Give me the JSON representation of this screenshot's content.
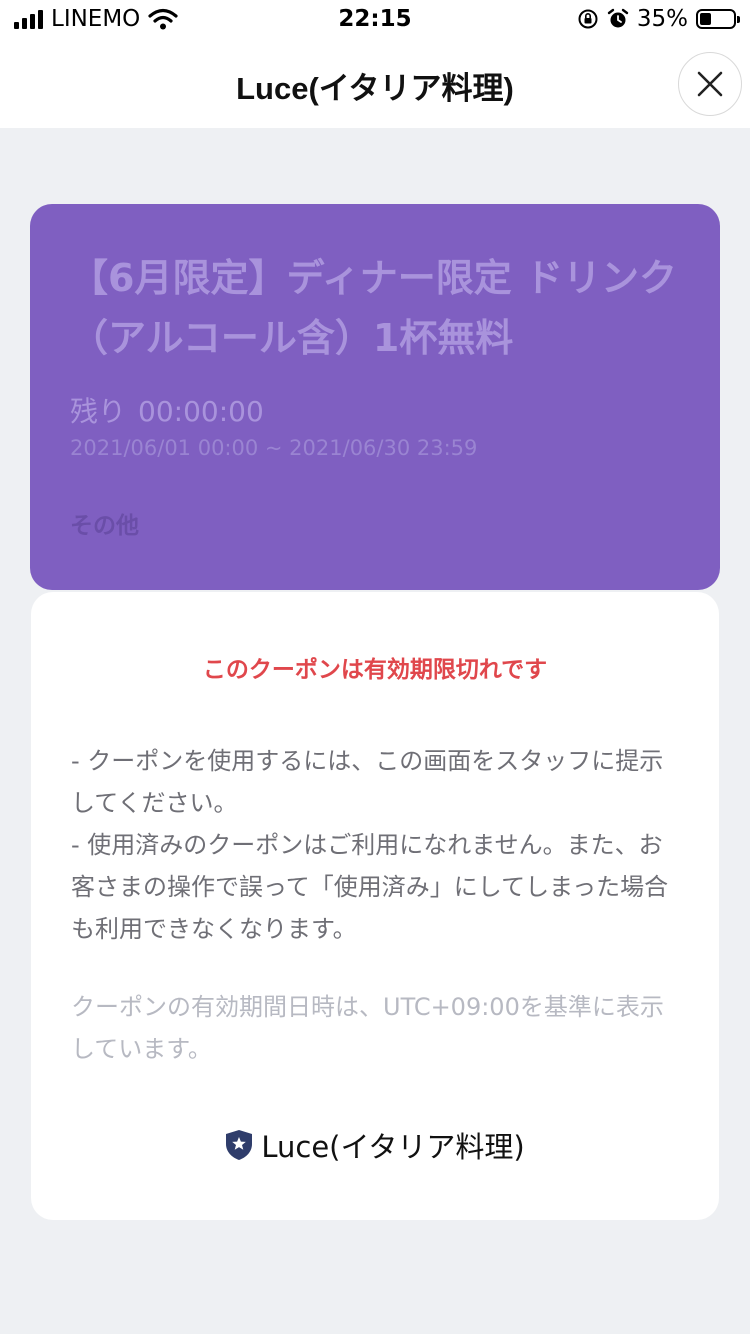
{
  "status_bar": {
    "carrier": "LINEMO",
    "time": "22:15",
    "battery_percent": "35%",
    "battery_level": 0.35,
    "icons": [
      "signal-bars-icon",
      "wifi-icon",
      "orientation-lock-icon",
      "alarm-icon",
      "battery-icon"
    ]
  },
  "header": {
    "title": "Luce(イタリア料理)",
    "close_icon": "close-icon"
  },
  "coupon": {
    "title": "【6月限定】ディナー限定 ドリンク（アルコール含）1杯無料",
    "remaining_label": "残り",
    "remaining_value": "00:00:00",
    "period": "2021/06/01 00:00 ~ 2021/06/30 23:59",
    "category": "その他",
    "color": "#7f5fc1"
  },
  "details": {
    "expired_message": "このクーポンは有効期限切れです",
    "note_1": "- クーポンを使用するには、この画面をスタッフに提示してください。",
    "note_2": "- 使用済みのクーポンはご利用になれません。また、お客さまの操作で誤って「使用済み」にしてしまった場合も利用できなくなります。",
    "timezone_note": "クーポンの有効期間日時は、UTC+09:00を基準に表示しています。",
    "brand_name": "Luce(イタリア料理)",
    "brand_icon": "shield-star-icon",
    "expired_color": "#e0474c"
  }
}
